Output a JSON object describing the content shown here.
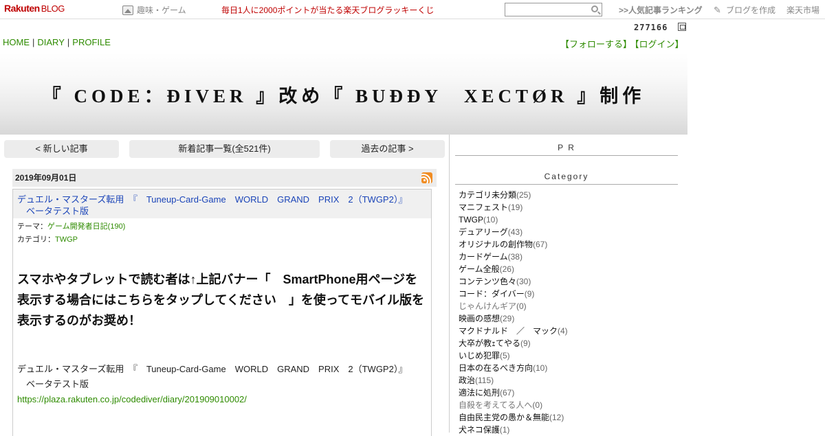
{
  "topbar": {
    "logo": "Rakuten",
    "logo_sub": "BLOG",
    "hobby": "趣味・ゲーム",
    "promo": "毎日1人に2000ポイントが当たる楽天ブログラッキーくじ",
    "search_value": "",
    "ranking": ">>人気記事ランキング",
    "create": "ブログを作成",
    "market": "楽天市場"
  },
  "counter": "277166",
  "nav": {
    "home": "HOME",
    "diary": "DIARY",
    "profile": "PROFILE",
    "sep": "|",
    "follow": "【フォローする】",
    "login": "【ログイン】"
  },
  "banner": {
    "title": "『 CODE：ÐIVER 』改め『 BUÐÐY　XECTØR 』制作"
  },
  "pager": {
    "newer": "< 新しい記事",
    "list": "新着記事一覧(全521件)",
    "older": "過去の記事 >"
  },
  "article": {
    "date": "2019年09月01日",
    "title_line1": "デュエル・マスターズ転用　『　Tuneup-Card-Game　WORLD　GRAND　PRIX　2（TWGP2）』",
    "title_line2": "ベータテスト版",
    "theme_label": "テーマ：",
    "theme_value": "ゲーム開発者日記(190)",
    "category_label": "カテゴリ：",
    "category_value": "TWGP",
    "body_big": "スマホやタブレットで読む者は↑上記バナー「　SmartPhone用ページを表示する場合にはこちらをタップしてください　」を使ってモバイル版を表示するのがお奨め！",
    "body_line1": "デュエル・マスターズ転用　『　Tuneup-Card-Game　WORLD　GRAND　PRIX　2（TWGP2）』",
    "body_line2": "ベータテスト版",
    "body_link": "https://plaza.rakuten.co.jp/codediver/diary/201909010002/"
  },
  "sidebar": {
    "pr": "P R",
    "category": "Category",
    "categories": [
      {
        "name": "カテゴリ未分類",
        "count": "(25)",
        "dim": false
      },
      {
        "name": "マニフェスト",
        "count": "(19)",
        "dim": false
      },
      {
        "name": "TWGP",
        "count": "(10)",
        "dim": false
      },
      {
        "name": "デュアリーグ",
        "count": "(43)",
        "dim": false
      },
      {
        "name": "オリジナルの創作物",
        "count": "(67)",
        "dim": false
      },
      {
        "name": "カードゲーム",
        "count": "(38)",
        "dim": false
      },
      {
        "name": "ゲーム全般",
        "count": "(26)",
        "dim": false
      },
      {
        "name": "コンテンツ色々",
        "count": "(30)",
        "dim": false
      },
      {
        "name": "コード：ダイバー",
        "count": "(9)",
        "dim": false
      },
      {
        "name": "じゃんけんギア",
        "count": "(0)",
        "dim": true
      },
      {
        "name": "映画の感想",
        "count": "(29)",
        "dim": false
      },
      {
        "name": "マクドナルド　／　マック",
        "count": "(4)",
        "dim": false
      },
      {
        "name": "大卒が教ｪてやる",
        "count": "(9)",
        "dim": false
      },
      {
        "name": "いじめ犯罪",
        "count": "(5)",
        "dim": false
      },
      {
        "name": "日本の在るべき方向",
        "count": "(10)",
        "dim": false
      },
      {
        "name": "政治",
        "count": "(115)",
        "dim": false
      },
      {
        "name": "適法に処刑",
        "count": "(67)",
        "dim": false
      },
      {
        "name": "自殺を考えてる人へ",
        "count": "(0)",
        "dim": true
      },
      {
        "name": "自由民主党の愚か＆無能",
        "count": "(12)",
        "dim": false
      },
      {
        "name": "犬ネコ保護",
        "count": "(1)",
        "dim": false
      }
    ]
  }
}
